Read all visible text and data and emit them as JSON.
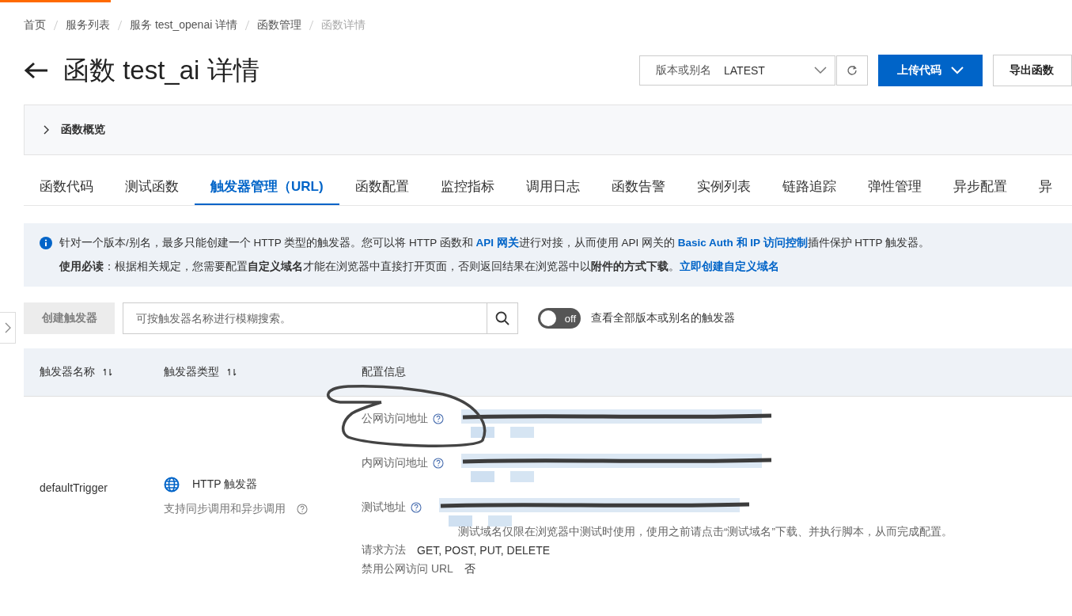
{
  "breadcrumb": [
    {
      "label": "首页",
      "current": false
    },
    {
      "label": "服务列表",
      "current": false
    },
    {
      "label": "服务 test_openai 详情",
      "current": false
    },
    {
      "label": "函数管理",
      "current": false
    },
    {
      "label": "函数详情",
      "current": true
    }
  ],
  "title": "函数 test_ai 详情",
  "version_select": {
    "label": "版本或别名",
    "value": "LATEST"
  },
  "buttons": [
    {
      "label": "上传代码",
      "kind": "primary"
    },
    {
      "label": "导出函数",
      "kind": "default"
    }
  ],
  "overview": {
    "label": "函数概览",
    "expanded": false
  },
  "tabs": [
    {
      "label": "函数代码",
      "selected": false
    },
    {
      "label": "测试函数",
      "selected": false
    },
    {
      "label": "触发器管理（URL)",
      "selected": true
    },
    {
      "label": "函数配置",
      "selected": false
    },
    {
      "label": "监控指标",
      "selected": false
    },
    {
      "label": "调用日志",
      "selected": false
    },
    {
      "label": "函数告警",
      "selected": false
    },
    {
      "label": "实例列表",
      "selected": false
    },
    {
      "label": "链路追踪",
      "selected": false
    },
    {
      "label": "弹性管理",
      "selected": false
    },
    {
      "label": "异步配置",
      "selected": false
    },
    {
      "label": "异",
      "selected": false
    }
  ],
  "notice": [
    [
      {
        "kind": "text",
        "text": "针对一个版本/别名，最多只能创建一个 HTTP 类型的触发器。您可以将 HTTP 函数和 "
      },
      {
        "kind": "link",
        "text": "API 网关"
      },
      {
        "kind": "text",
        "text": "进行对接，从而使用 API 网关的 "
      },
      {
        "kind": "link",
        "text": "Basic Auth 和 IP 访问控制"
      },
      {
        "kind": "text",
        "text": "插件保护 HTTP 触发器。"
      }
    ],
    [
      {
        "kind": "bold",
        "text": "使用必读"
      },
      {
        "kind": "text",
        "text": "：根据相关规定，您需要配置"
      },
      {
        "kind": "bold",
        "text": "自定义域名"
      },
      {
        "kind": "text",
        "text": "才能在浏览器中直接打开页面，否则返回结果在浏览器中以"
      },
      {
        "kind": "bold",
        "text": "附件的方式下载"
      },
      {
        "kind": "text",
        "text": "。"
      },
      {
        "kind": "link",
        "text": "立即创建自定义域名"
      }
    ]
  ],
  "toolbar": {
    "create_button": {
      "label": "创建触发器",
      "disabled": true
    },
    "search": {
      "placeholder": "可按触发器名称进行模糊搜索。"
    },
    "toggle": {
      "on": false,
      "label": "off",
      "caption": "查看全部版本或别名的触发器"
    }
  },
  "table": {
    "columns": [
      {
        "label": "触发器名称",
        "sortable": true
      },
      {
        "label": "触发器类型",
        "sortable": true
      },
      {
        "label": "配置信息",
        "sortable": false
      }
    ],
    "rows": [
      {
        "name": "defaultTrigger",
        "type": "HTTP 触发器",
        "type_note": "支持同步调用和异步调用",
        "config": [
          {
            "kind": "address",
            "label": "公网访问地址"
          },
          {
            "kind": "address",
            "label": "内网访问地址"
          },
          {
            "kind": "address",
            "label": "测试地址",
            "note": "测试域名仅限在浏览器中测试时使用，使用之前请点击“测试域名”下载、并执行脚本，从而完成配置。"
          },
          {
            "kind": "text",
            "label": "请求方法",
            "value": "GET, POST, PUT, DELETE"
          },
          {
            "kind": "text",
            "label": "禁用公网访问 URL",
            "value": "否"
          }
        ]
      }
    ]
  }
}
